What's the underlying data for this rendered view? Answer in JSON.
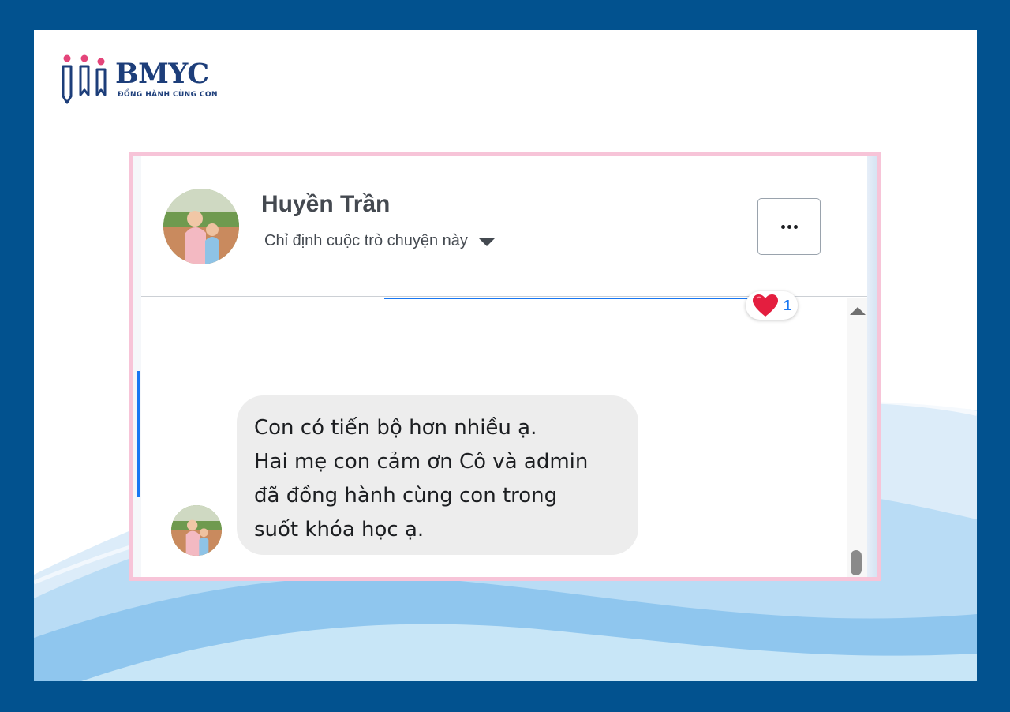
{
  "brand": {
    "name": "BMYC",
    "tagline": "ĐỒNG HÀNH CÙNG CON",
    "logo_icon": "three-people-icon"
  },
  "chat": {
    "contact_name": "Huyền Trần",
    "assign_label": "Chỉ định cuộc trò chuyện này",
    "assign_icon": "caret-down-icon",
    "more_icon": "more-dots-icon",
    "reaction": {
      "icon": "heart-icon",
      "count": "1"
    },
    "message_lines": [
      "Con có tiến bộ hơn nhiều ạ.",
      "Hai mẹ con cảm ơn Cô và admin",
      "đã đồng hành cùng con trong",
      "suốt khóa học ạ."
    ]
  },
  "colors": {
    "outer_border": "#02528f",
    "card_border": "#f7c4d8",
    "bubble": "#ededed",
    "accent": "#1877f2",
    "heart": "#e41e3f",
    "brand_text": "#1d3e7a",
    "brand_pink": "#e4457a"
  }
}
